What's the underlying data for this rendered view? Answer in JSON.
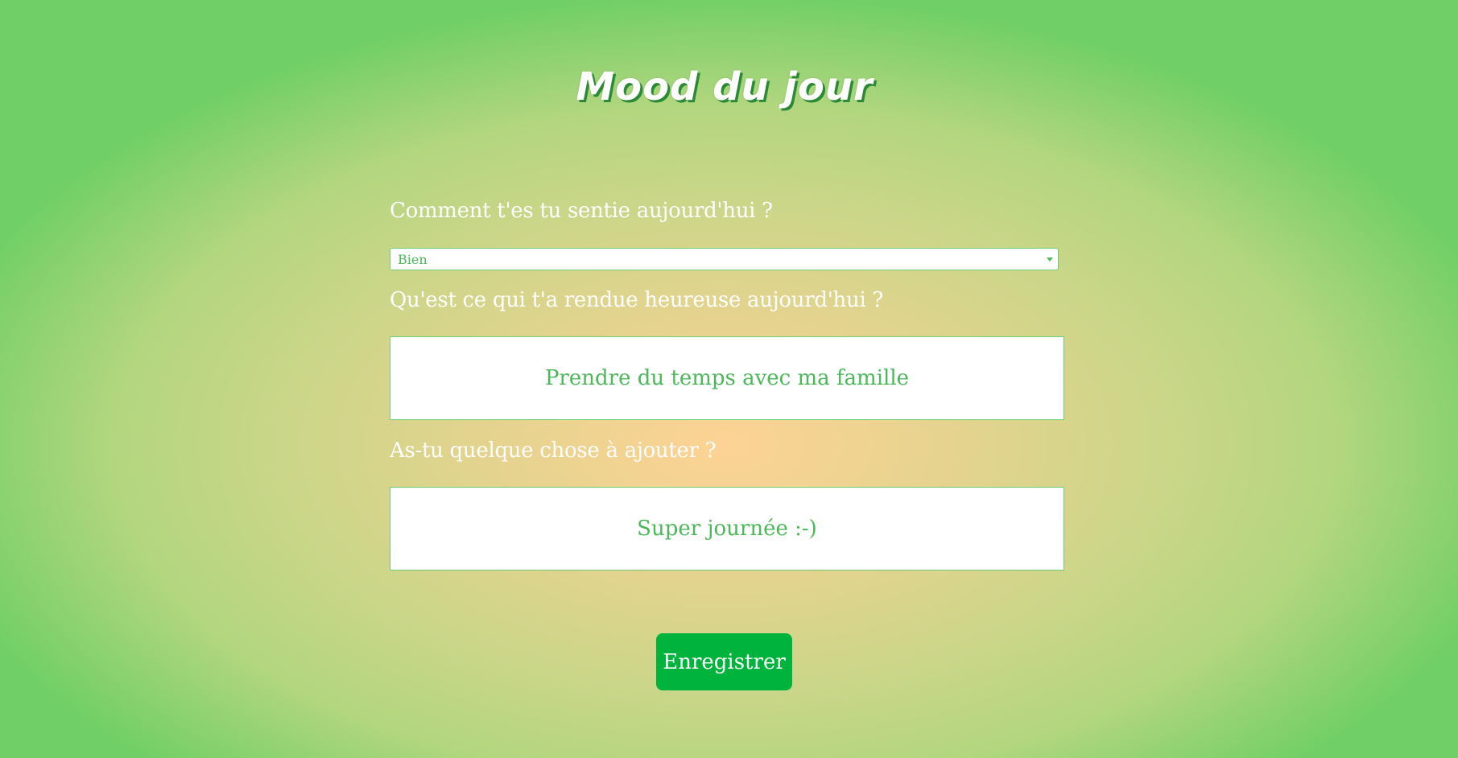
{
  "header": {
    "title": "Mood du jour"
  },
  "form": {
    "q_mood": "Comment t'es tu sentie aujourd'hui ?",
    "mood_select": {
      "selected": "Bien"
    },
    "q_happy": "Qu'est ce qui t'a rendue heureuse aujourd'hui ?",
    "happy_value": "Prendre du temps avec ma famille",
    "q_extra": "As-tu quelque chose à ajouter ?",
    "extra_value": "Super journée :-)",
    "save_label": "Enregistrer"
  },
  "colors": {
    "accent": "#00b33c",
    "field_text": "#4cb85a",
    "field_border": "#6ccf74",
    "background_center": "#fdd394",
    "background_edge": "#70cf66"
  },
  "icons": {
    "select_arrow": "chevron-down-icon"
  }
}
